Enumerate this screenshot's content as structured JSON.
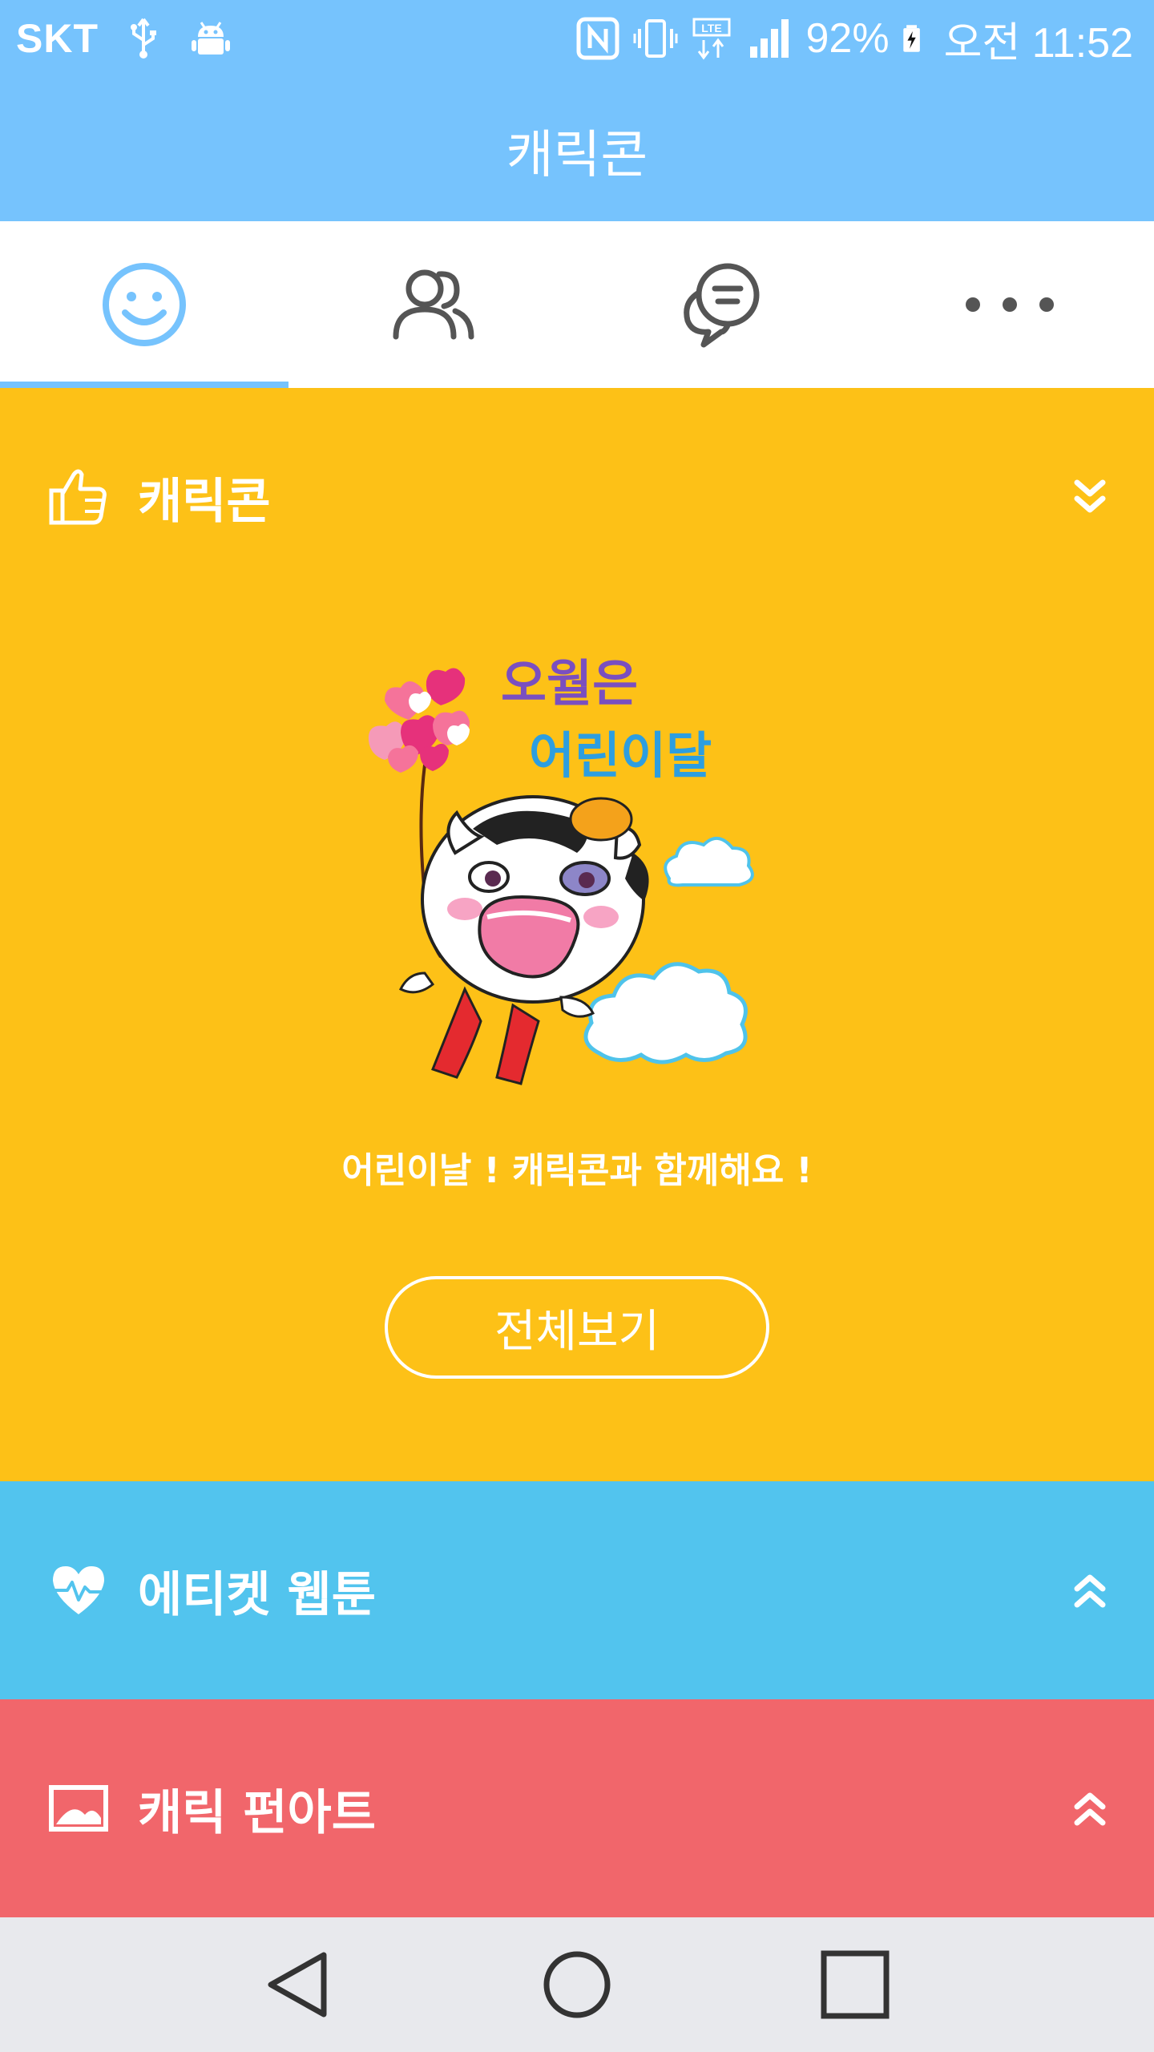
{
  "status_bar": {
    "carrier": "SKT",
    "battery": "92%",
    "time": "오전 11:52",
    "icons": [
      "usb-icon",
      "android-debug-icon",
      "nfc-icon",
      "vibrate-icon",
      "lte-icon",
      "signal-icon",
      "battery-charging-icon"
    ]
  },
  "app_bar": {
    "title": "캐릭콘"
  },
  "tabs": [
    {
      "name": "emoticon-tab",
      "icon": "smiley-icon",
      "selected": true
    },
    {
      "name": "friends-tab",
      "icon": "people-icon",
      "selected": false
    },
    {
      "name": "chat-tab",
      "icon": "chat-bubbles-icon",
      "selected": false
    },
    {
      "name": "more-tab",
      "icon": "more-dots-icon",
      "selected": false
    }
  ],
  "sections": {
    "charicon": {
      "title": "캐릭콘",
      "icon": "thumbs-up-icon",
      "chevron": "double-chevron-down-icon",
      "caption": "어린이날 ! 캐릭콘과 함께해요 !",
      "button_label": "전체보기",
      "banner_text_line1": "오월은",
      "banner_text_line2": "어린이달"
    },
    "webtoon": {
      "title": "에티켓 웹툰",
      "icon": "heart-pulse-icon",
      "chevron": "double-chevron-up-icon"
    },
    "fanart": {
      "title": "캐릭 펀아트",
      "icon": "image-icon",
      "chevron": "double-chevron-up-icon"
    }
  },
  "nav_bar": [
    "back-icon",
    "home-icon",
    "recents-icon"
  ],
  "colors": {
    "primary": "#76c3fd",
    "yellow": "#fdc117",
    "blue": "#52c4ee",
    "red": "#f1666b",
    "nav": "#e8e9ed"
  }
}
